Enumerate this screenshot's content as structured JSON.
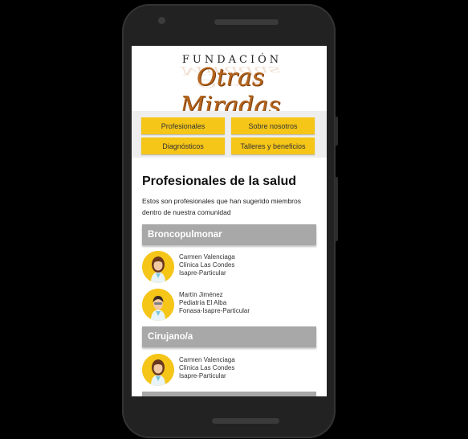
{
  "logo": {
    "top": "FUNDACIÓN",
    "main": "Otras Miradas"
  },
  "menu": [
    {
      "label": "Profesionales"
    },
    {
      "label": "Sobre nosotros"
    },
    {
      "label": "Diagnósticos"
    },
    {
      "label": "Talleres y beneficios"
    }
  ],
  "page": {
    "title": "Profesionales de la salud",
    "intro": "Estos son profesionales que han sugerido miembros dentro de nuestra comunidad"
  },
  "categories": [
    {
      "label": "Broncopulmonar"
    },
    {
      "label": "Cirujano/a"
    }
  ],
  "professionals": [
    {
      "name": "Carmen Valenciaga",
      "place": "Clínica Las Condes",
      "coverage": "Isapre-Particular"
    },
    {
      "name": "Martín Jiménez",
      "place": "Pediatría El Alba",
      "coverage": "Fonasa-Isapre-Particular"
    },
    {
      "name": "Carmen Valenciaga",
      "place": "Clínica Las Condes",
      "coverage": "Isapre-Particular"
    }
  ]
}
